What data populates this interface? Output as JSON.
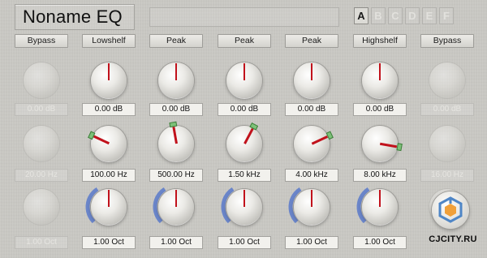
{
  "plugin": {
    "title": "Noname EQ",
    "preset_name": "",
    "slots": [
      {
        "label": "A",
        "active": true
      },
      {
        "label": "B",
        "active": false
      },
      {
        "label": "C",
        "active": false
      },
      {
        "label": "D",
        "active": false
      },
      {
        "label": "E",
        "active": false
      },
      {
        "label": "F",
        "active": false
      }
    ]
  },
  "bands": [
    {
      "type": "Bypass",
      "enabled": false,
      "gain": "0.00 dB",
      "freq": "20.00 Hz",
      "q": "1.00 Oct",
      "freq_angle": 0,
      "q_level": 0
    },
    {
      "type": "Lowshelf",
      "enabled": true,
      "gain": "0.00 dB",
      "freq": "100.00 Hz",
      "q": "1.00 Oct",
      "freq_angle": -65,
      "q_level": 0.38
    },
    {
      "type": "Peak",
      "enabled": true,
      "gain": "0.00 dB",
      "freq": "500.00 Hz",
      "q": "1.00 Oct",
      "freq_angle": -10,
      "q_level": 0.38
    },
    {
      "type": "Peak",
      "enabled": true,
      "gain": "0.00 dB",
      "freq": "1.50 kHz",
      "q": "1.00 Oct",
      "freq_angle": 28,
      "q_level": 0.38
    },
    {
      "type": "Peak",
      "enabled": true,
      "gain": "0.00 dB",
      "freq": "4.00 kHz",
      "q": "1.00 Oct",
      "freq_angle": 65,
      "q_level": 0.38
    },
    {
      "type": "Highshelf",
      "enabled": true,
      "gain": "0.00 dB",
      "freq": "8.00 kHz",
      "q": "1.00 Oct",
      "freq_angle": 100,
      "q_level": 0.38
    },
    {
      "type": "Bypass",
      "enabled": false,
      "gain": "0.00 dB",
      "freq": "16.00 Hz",
      "q": "1.00 Oct",
      "freq_angle": 0,
      "q_level": 0
    }
  ],
  "watermark": "CJCITY.RU",
  "colors": {
    "pointer": "#c1121c",
    "freq_tab": "#7cc178",
    "q_arc": "#6a85c9"
  },
  "logo_icon": "cube-logo-icon"
}
